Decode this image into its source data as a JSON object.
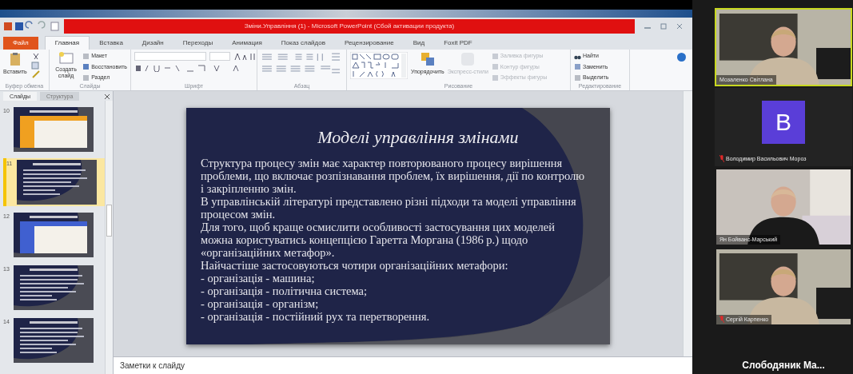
{
  "window": {
    "title": "Зміни.Управління (1) - Microsoft PowerPoint (Сбой активации продукта)"
  },
  "ribbon": {
    "tabs": [
      {
        "label": "Файл",
        "kind": "file",
        "selected": false
      },
      {
        "label": "Главная",
        "kind": "tab",
        "selected": true
      },
      {
        "label": "Вставка",
        "kind": "tab",
        "selected": false
      },
      {
        "label": "Дизайн",
        "kind": "tab",
        "selected": false
      },
      {
        "label": "Переходы",
        "kind": "tab",
        "selected": false
      },
      {
        "label": "Анимация",
        "kind": "tab",
        "selected": false
      },
      {
        "label": "Показ слайдов",
        "kind": "tab",
        "selected": false
      },
      {
        "label": "Рецензирование",
        "kind": "tab",
        "selected": false
      },
      {
        "label": "Вид",
        "kind": "tab",
        "selected": false
      },
      {
        "label": "Foxit PDF",
        "kind": "tab",
        "selected": false
      }
    ],
    "groups": [
      {
        "label": "Буфер обмена",
        "kind": "clipboard",
        "items": [
          {
            "label": "Вставить",
            "disabled": false
          }
        ]
      },
      {
        "label": "Слайды",
        "kind": "slides",
        "items": [
          {
            "label": "Создать слайд",
            "disabled": false
          },
          {
            "label": "Макет",
            "disabled": false
          },
          {
            "label": "Восстановить",
            "disabled": false
          },
          {
            "label": "Раздел",
            "disabled": false
          }
        ]
      },
      {
        "label": "Шрифт",
        "kind": "font"
      },
      {
        "label": "Абзац",
        "kind": "paragraph"
      },
      {
        "label": "Рисование",
        "kind": "drawing",
        "items": [
          {
            "label": "Упорядочить",
            "disabled": false
          },
          {
            "label": "Экспресс-стили",
            "disabled": true
          },
          {
            "label": "Заливка фигуры",
            "disabled": true
          },
          {
            "label": "Контур фигуры",
            "disabled": true
          },
          {
            "label": "Эффекты фигуры",
            "disabled": true
          }
        ]
      },
      {
        "label": "Редактирование",
        "kind": "editing",
        "items": [
          {
            "label": "Найти",
            "disabled": false
          },
          {
            "label": "Заменить",
            "disabled": false
          },
          {
            "label": "Выделить",
            "disabled": false
          }
        ]
      }
    ]
  },
  "slides_panel": {
    "tabs": [
      {
        "label": "Слайды",
        "selected": true
      },
      {
        "label": "Структура",
        "selected": false
      }
    ],
    "slides": [
      {
        "number": "10",
        "kind": "table",
        "color": "#f0a020",
        "selected": false
      },
      {
        "number": "11",
        "kind": "text",
        "selected": true
      },
      {
        "number": "12",
        "kind": "table",
        "color": "#4060d0",
        "selected": false
      },
      {
        "number": "13",
        "kind": "text",
        "selected": false
      },
      {
        "number": "14",
        "kind": "text",
        "selected": false
      }
    ]
  },
  "slide": {
    "title": "Моделі управління змінами",
    "paragraphs": [
      "Структура процесу змін має характер повторюваного процесу вирішення проблеми, що включає розпізнавання проблем, їх вирішення, дії по контролю і закріпленню змін.",
      "В управлінській літературі представлено різні підходи та моделі управління процесом змін.",
      "Для того, щоб краще осмислити особливості застосування цих моделей можна користуватись концепцією Гаретта Моргана (1986 р.) щодо «організаційних метафор».",
      "Найчастіше застосовуються чотири організаційних метафори:",
      "- організація - машина;",
      "- організація - політична система;",
      "- організація - організм;",
      "- організація - постійний рух та перетворення."
    ]
  },
  "notes": {
    "placeholder": "Заметки к слайду"
  },
  "participants": [
    {
      "name": "Мозаленко Світлана",
      "kind": "video",
      "speaking": true,
      "muted": false
    },
    {
      "name": "Володимир Васильович Мороз",
      "kind": "avatar",
      "letter": "B",
      "speaking": false,
      "muted": true
    },
    {
      "name": "Ян Бойванс-Марський",
      "kind": "video",
      "speaking": false,
      "muted": false
    },
    {
      "name": "Сергій Карпенко",
      "kind": "video",
      "speaking": false,
      "muted": true
    }
  ],
  "sharer": {
    "name": "Слободяник Ма..."
  }
}
